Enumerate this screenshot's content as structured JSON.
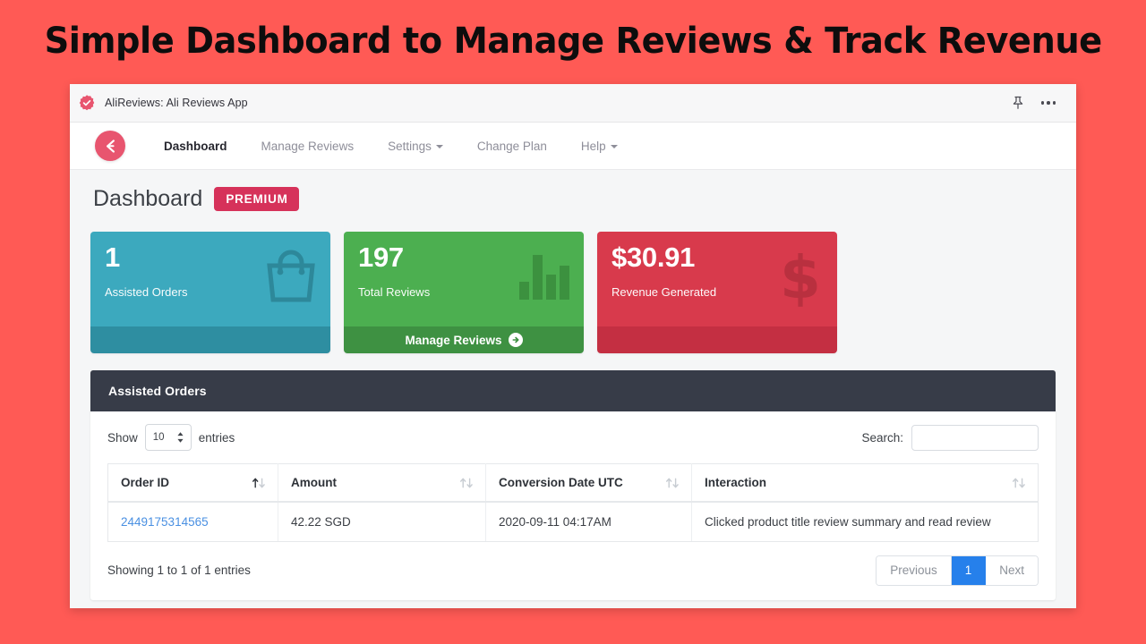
{
  "banner": {
    "title": "Simple Dashboard to Manage Reviews & Track Revenue",
    "background_color": "#FF5A55"
  },
  "appbar": {
    "app_name": "AliReviews: Ali Reviews App",
    "badge_icon": "verified-seal-icon",
    "pin_icon": "pin-icon",
    "more_icon": "ellipsis-icon"
  },
  "navbar": {
    "brand_icon": "alireviews-logo-icon",
    "brand_color": "#E8556F",
    "items": [
      {
        "label": "Dashboard",
        "active": true,
        "has_caret": false
      },
      {
        "label": "Manage Reviews",
        "active": false,
        "has_caret": false
      },
      {
        "label": "Settings",
        "active": false,
        "has_caret": true
      },
      {
        "label": "Change Plan",
        "active": false,
        "has_caret": false
      },
      {
        "label": "Help",
        "active": false,
        "has_caret": true
      }
    ]
  },
  "page": {
    "title": "Dashboard",
    "badge": "PREMIUM",
    "badge_color": "#D6325A"
  },
  "cards": [
    {
      "value": "1",
      "label": "Assisted Orders",
      "color": "#3CA9BE",
      "footer_color": "#2E8EA1",
      "icon": "shopping-bag-icon",
      "footer_label": ""
    },
    {
      "value": "197",
      "label": "Total Reviews",
      "color": "#4CAF50",
      "footer_color": "#3E9142",
      "icon": "bar-chart-icon",
      "footer_label": "Manage Reviews"
    },
    {
      "value": "$30.91",
      "label": "Revenue Generated",
      "color": "#D83A4C",
      "footer_color": "#C42F42",
      "icon": "dollar-sign-icon",
      "footer_label": ""
    }
  ],
  "panel": {
    "title": "Assisted Orders",
    "header_color": "#373C48"
  },
  "controls": {
    "show_label": "Show",
    "entries_label": "entries",
    "page_length": "10",
    "search_label": "Search:",
    "search_value": "",
    "search_placeholder": ""
  },
  "table": {
    "columns": [
      {
        "label": "Order ID",
        "sort": "asc"
      },
      {
        "label": "Amount",
        "sort": "none"
      },
      {
        "label": "Conversion Date UTC",
        "sort": "none"
      },
      {
        "label": "Interaction",
        "sort": "none"
      }
    ],
    "rows": [
      {
        "order_id": "2449175314565",
        "amount": "42.22 SGD",
        "conversion_date": "2020-09-11 04:17AM",
        "interaction": "Clicked product title review summary and read review"
      }
    ]
  },
  "footer": {
    "entries_info": "Showing 1 to 1 of 1 entries",
    "pagination": {
      "previous": "Previous",
      "pages": [
        "1"
      ],
      "next": "Next",
      "active_page": "1",
      "active_color": "#2680EB"
    }
  }
}
